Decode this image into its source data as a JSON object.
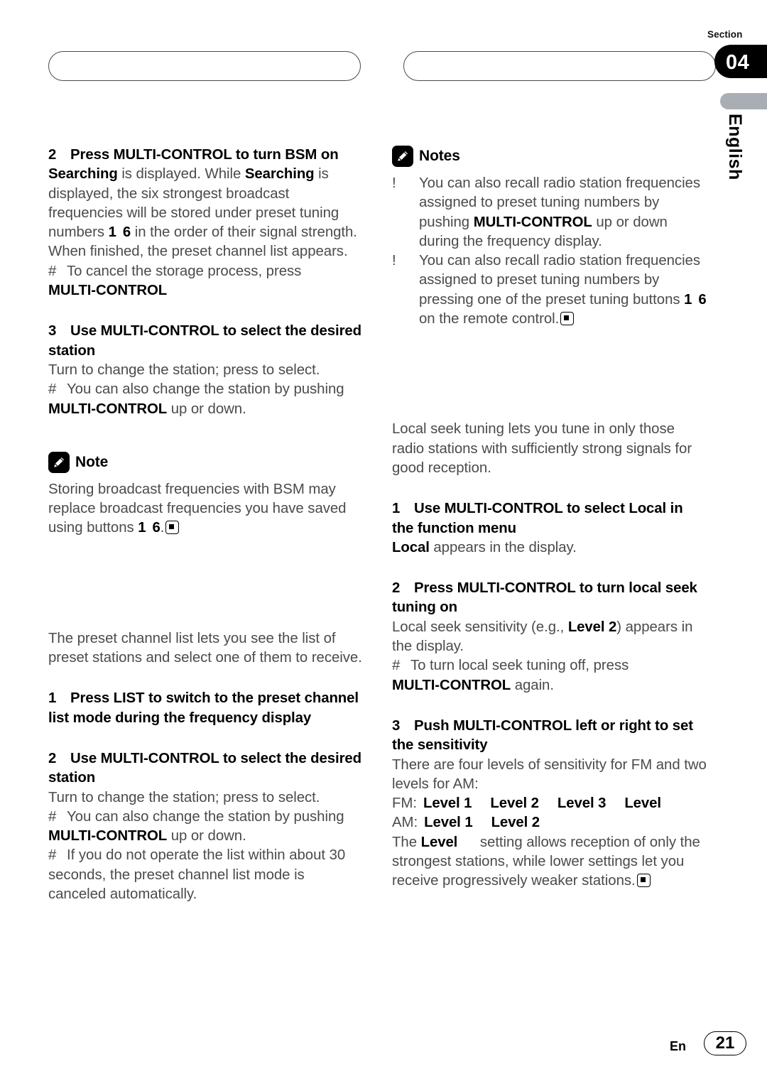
{
  "header": {
    "section_label": "Section",
    "section_number": "04",
    "language_tab": "English",
    "left_title": "",
    "right_title": ""
  },
  "footer": {
    "lang_code": "En",
    "page_number": "21"
  },
  "left_column": {
    "step2": {
      "number": "2",
      "heading": "Press MULTI-CONTROL to turn BSM on",
      "body_1_bold": "Searching",
      "body_1_mid": " is displayed. While ",
      "body_1_bold2": "Searching",
      "body_1_rest": " is displayed, the six strongest broadcast frequencies will be stored under preset tuning numbers ",
      "body_1_b1": "1",
      "body_1_b6": "6",
      "body_1_tail": " in the order of their signal strength. When finished, the preset channel list appears.",
      "hash_mark": "#",
      "hash_text": "To cancel the storage process, press",
      "hash_bold": "MULTI-CONTROL"
    },
    "step3": {
      "number": "3",
      "heading": "Use MULTI-CONTROL to select the desired station",
      "body": "Turn to change the station; press to select.",
      "hash_mark": "#",
      "hash_text": "You can also change the station by pushing",
      "hash_bold": "MULTI-CONTROL",
      "hash_tail": " up or down."
    },
    "note": {
      "icon": "pencil-icon",
      "title": "Note",
      "text_head": "Storing broadcast frequencies with BSM may replace broadcast frequencies you have saved using buttons ",
      "b1": "1",
      "b6": "6",
      "text_tail": "."
    },
    "preset_list": {
      "intro": "The preset channel list lets you see the list of preset stations and select one of them to receive.",
      "step1": {
        "number": "1",
        "heading": "Press LIST to switch to the preset channel list mode during the frequency display"
      },
      "step2": {
        "number": "2",
        "heading": "Use MULTI-CONTROL to select the desired station",
        "body": "Turn to change the station; press to select.",
        "hash1_mark": "#",
        "hash1_text": "You can also change the station by pushing",
        "hash1_bold": "MULTI-CONTROL",
        "hash1_tail": " up or down.",
        "hash2_mark": "#",
        "hash2_text": "If you do not operate the list within about 30 seconds, the preset channel list mode is canceled automatically."
      }
    }
  },
  "right_column": {
    "notes": {
      "icon": "pencil-icon",
      "title": "Notes",
      "items": [
        {
          "mark": "!",
          "text_a": "You can also recall radio station frequencies assigned to preset tuning numbers by pushing ",
          "bold": "MULTI-CONTROL",
          "text_b": " up or down during the frequency display."
        },
        {
          "mark": "!",
          "text_a": "You can also recall radio station frequencies assigned to preset tuning numbers by pressing one of the preset tuning buttons ",
          "b1": "1",
          "b6": "6",
          "text_b": " on the remote control."
        }
      ]
    },
    "local_seek": {
      "intro": "Local seek tuning lets you tune in only those radio stations with sufficiently strong signals for good reception.",
      "step1": {
        "number": "1",
        "heading": "Use MULTI-CONTROL to select Local in the function menu",
        "body_bold": "Local",
        "body_rest": " appears in the display."
      },
      "step2": {
        "number": "2",
        "heading": "Press MULTI-CONTROL to turn local seek tuning on",
        "body_a": "Local seek sensitivity (e.g., ",
        "body_bold": "Level 2",
        "body_b": ") appears in the display.",
        "hash_mark": "#",
        "hash_text": "To turn local seek tuning off, press",
        "hash_bold": "MULTI-CONTROL",
        "hash_tail": " again."
      },
      "step3": {
        "number": "3",
        "heading": "Push MULTI-CONTROL left or right to set the sensitivity",
        "body": "There are four levels of sensitivity for FM and two levels for AM:",
        "fm_label": "FM:",
        "fm_levels": [
          "Level 1",
          "Level 2",
          "Level 3",
          "Level"
        ],
        "am_label": "AM:",
        "am_levels": [
          "Level 1",
          "Level 2"
        ],
        "closing_a": "The ",
        "closing_bold": "Level",
        "closing_b": " setting allows reception of only the strongest stations, while lower settings let you receive progressively weaker stations."
      }
    }
  }
}
